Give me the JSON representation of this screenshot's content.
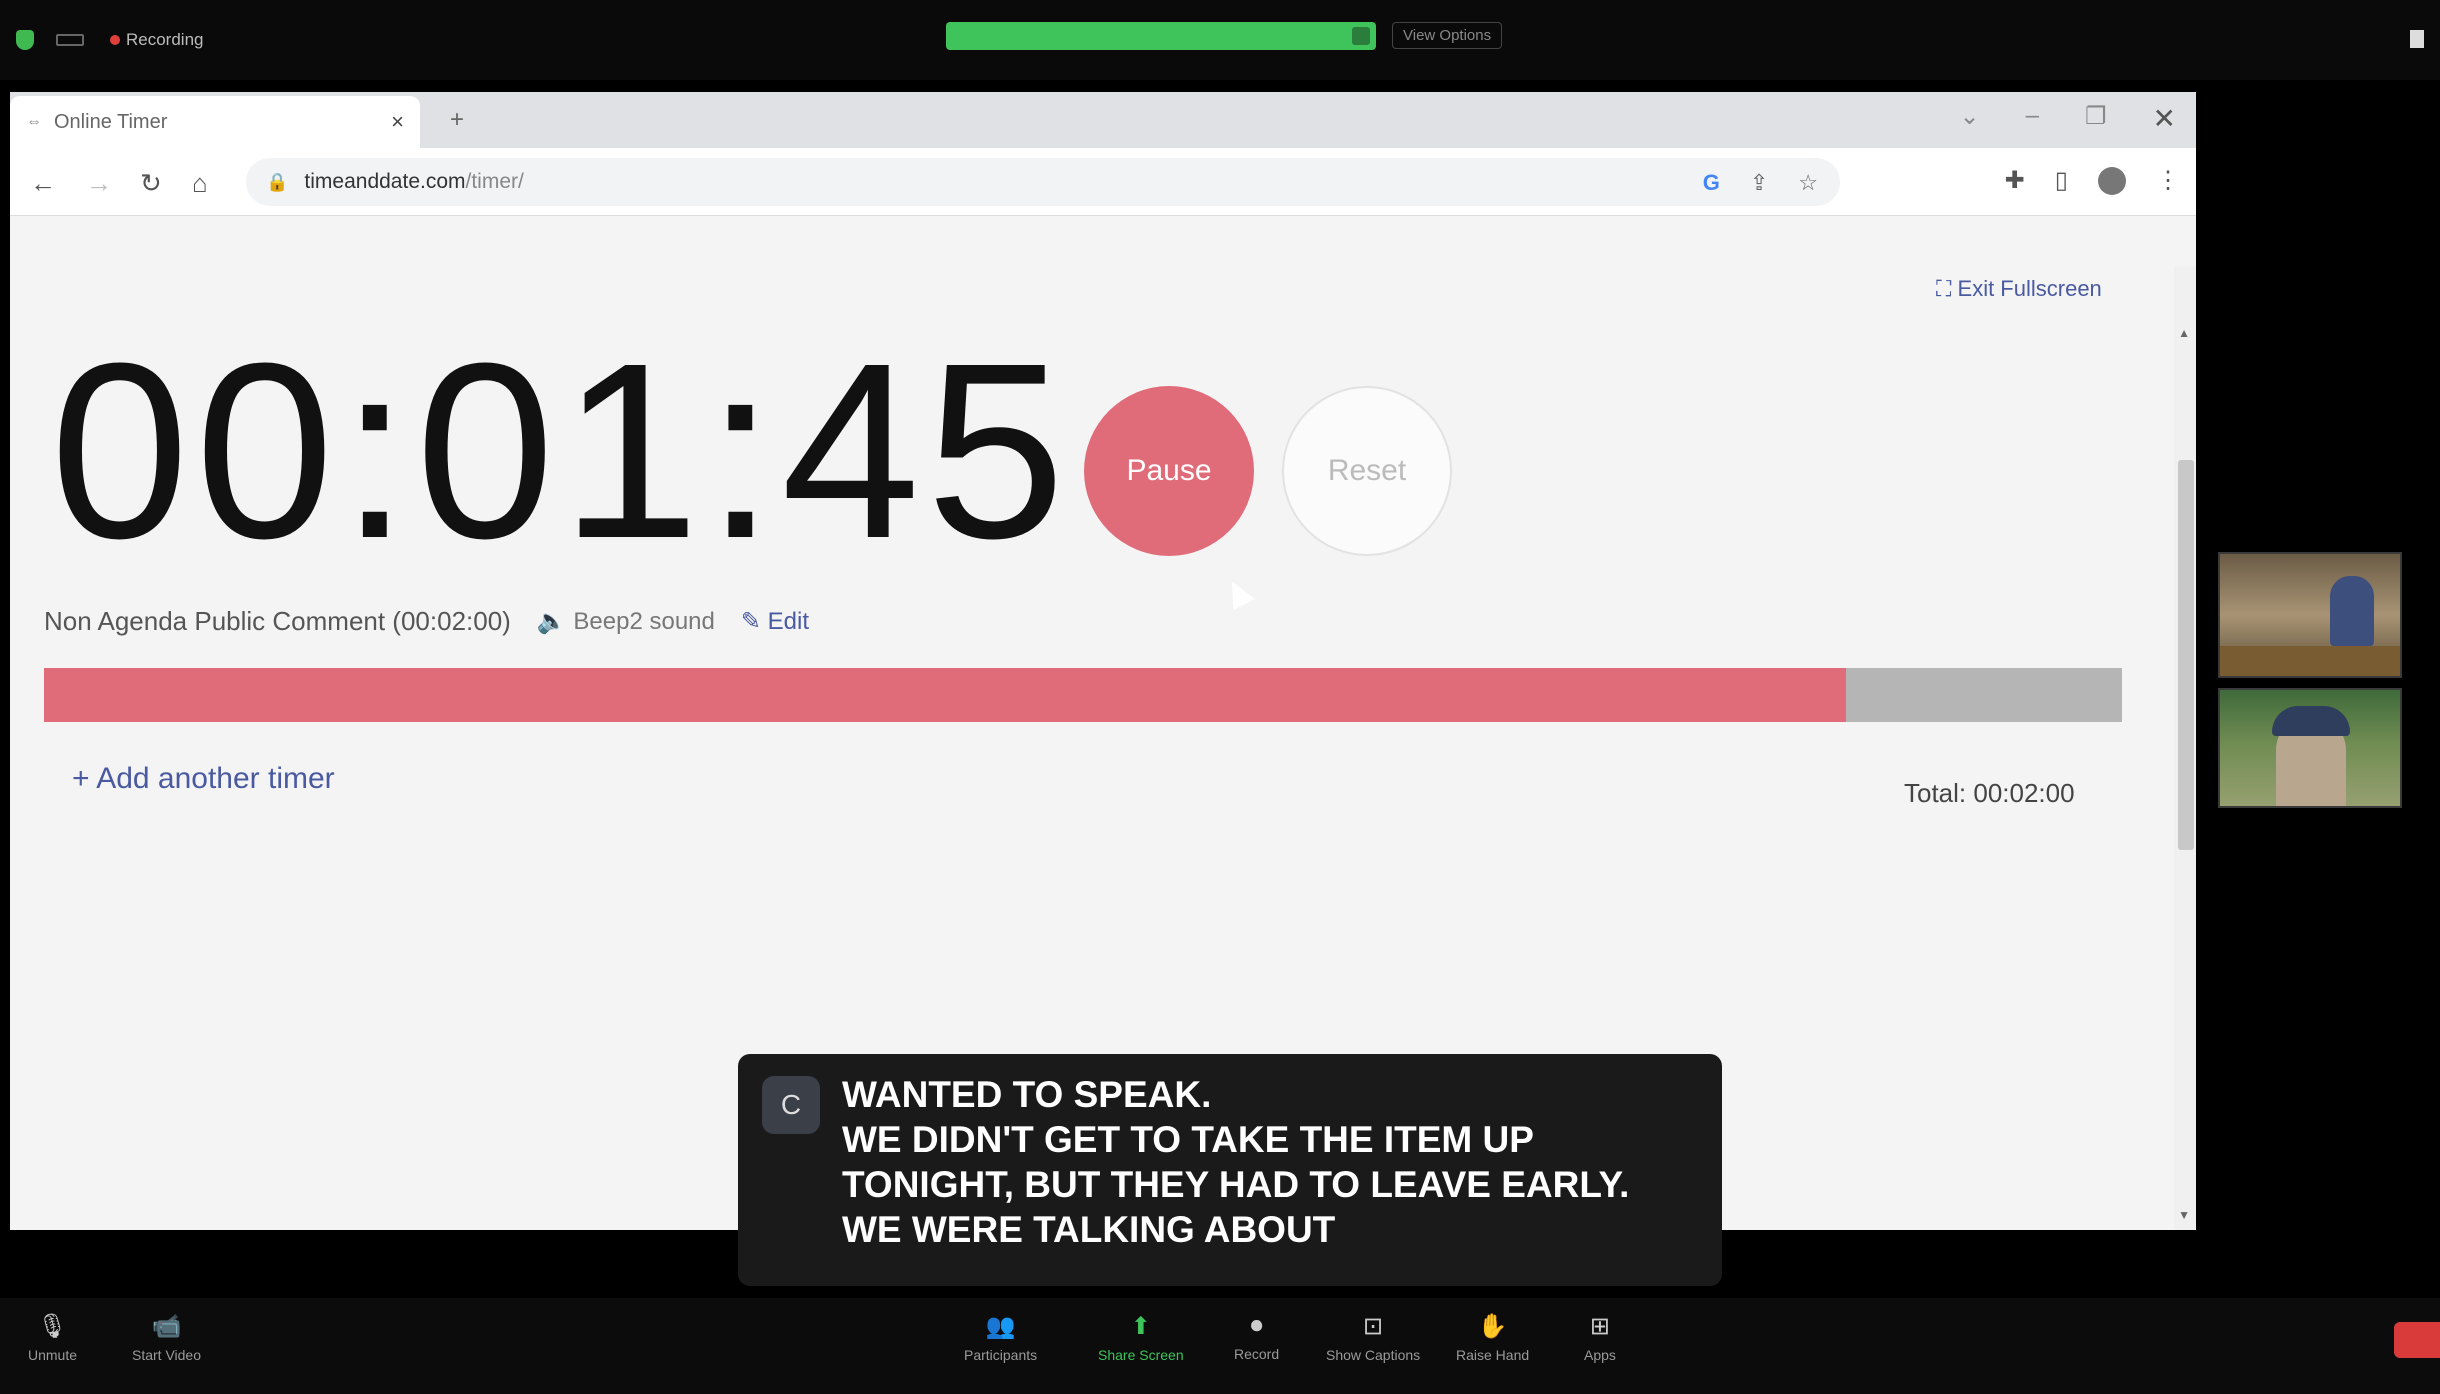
{
  "zoom_top": {
    "recording_label": "Recording",
    "view_options": "View Options"
  },
  "browser": {
    "tab_title": "Online Timer",
    "tab_close": "×",
    "new_tab": "+",
    "url_host": "timeanddate.com",
    "url_path": "/timer/"
  },
  "page": {
    "exit_fullscreen": "Exit Fullscreen",
    "timer_value": "00:01:45",
    "pause_label": "Pause",
    "reset_label": "Reset",
    "timer_name": "Non Agenda Public Comment (00:02:00)",
    "sound_label": "Beep2 sound",
    "edit_label": "Edit",
    "progress_fraction": 0.867,
    "add_timer_label": "+ Add another timer",
    "total_label": "Total: 00:02:00"
  },
  "caption": {
    "initial": "C",
    "text": "WANTED TO SPEAK.\n WE DIDN'T GET TO TAKE THE ITEM UP\nTONIGHT, BUT THEY HAD TO LEAVE EARLY.\nWE WERE TALKING ABOUT"
  },
  "zoom_bottom": {
    "unmute": "Unmute",
    "start_video": "Start Video",
    "participants": "Participants",
    "share_screen": "Share Screen",
    "record": "Record",
    "show_captions": "Show Captions",
    "raise_hand": "Raise Hand",
    "apps": "Apps"
  },
  "colors": {
    "accent": "#e06c7a",
    "progress_track": "#b5b5b5",
    "share_green": "#3ec45a",
    "link": "#4a5aa0"
  }
}
